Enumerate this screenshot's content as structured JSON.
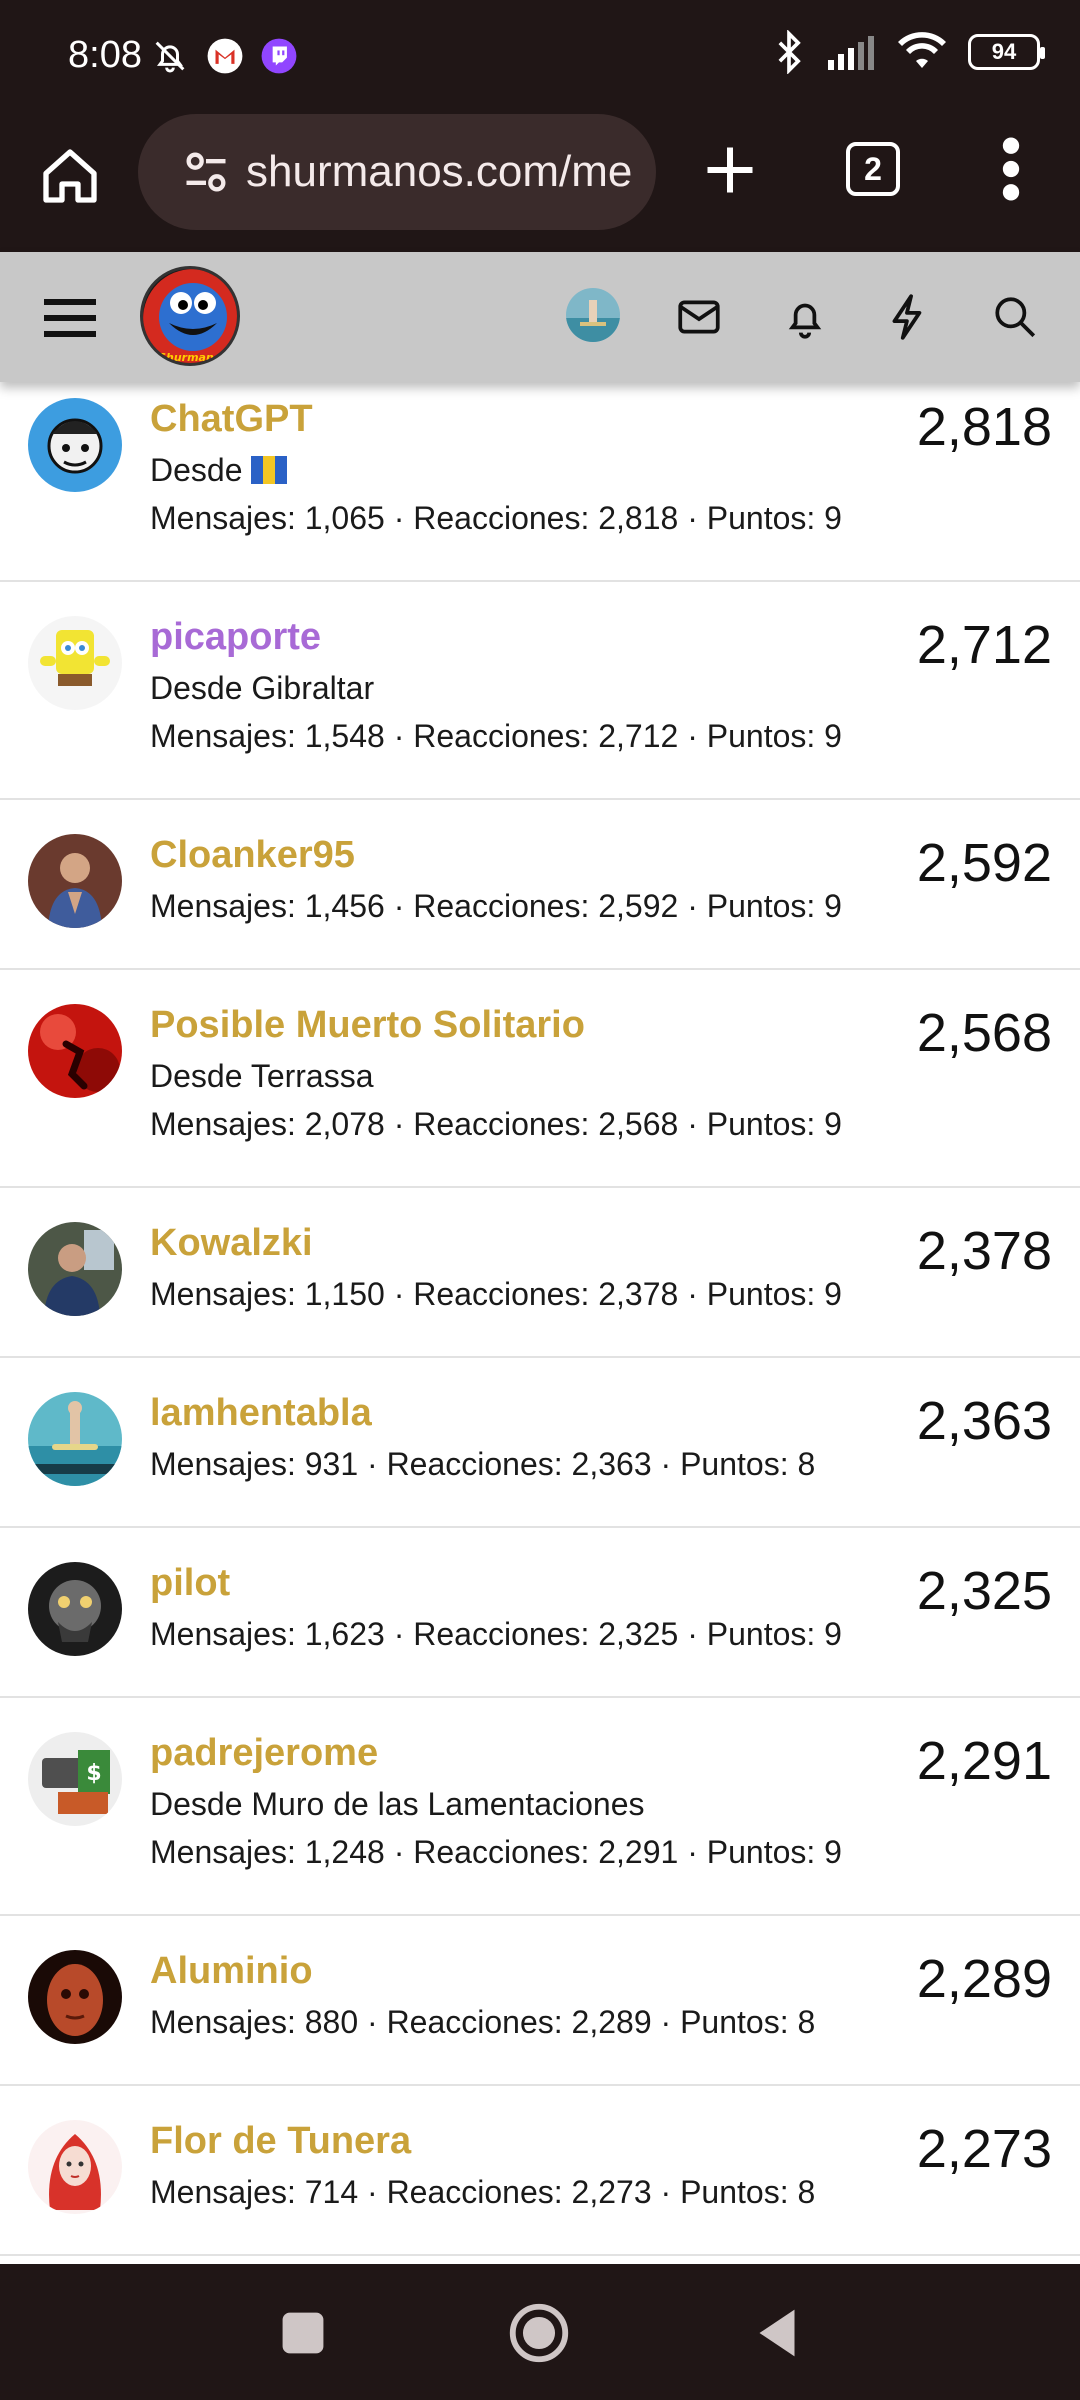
{
  "status_bar": {
    "time": "8:08",
    "battery": "94",
    "icons": [
      "mute-bell-icon",
      "gmail-icon",
      "twitch-icon",
      "bluetooth-icon",
      "signal-icon",
      "wifi-icon"
    ]
  },
  "browser": {
    "url": "shurmanos.com/me",
    "tab_count": "2"
  },
  "site_header": {
    "logo_text": "Shurmanos"
  },
  "members": [
    {
      "name": "ChatGPT",
      "location": "Desde",
      "has_flag": true,
      "stats": "Mensajes: 1,065 · Reacciones: 2,818 · Puntos: 9",
      "score": "2,818",
      "name_color": "#c9a23a",
      "avatar": "avatar-chatgpt"
    },
    {
      "name": "picaporte",
      "location": "Desde Gibraltar",
      "stats": "Mensajes: 1,548 · Reacciones: 2,712 · Puntos: 9",
      "score": "2,712",
      "name_color": "#a86ad6",
      "avatar": "avatar-picaporte"
    },
    {
      "name": "Cloanker95",
      "location": "",
      "stats": "Mensajes: 1,456 · Reacciones: 2,592 · Puntos: 9",
      "score": "2,592",
      "name_color": "#c9a23a",
      "avatar": "avatar-cloanker95"
    },
    {
      "name": "Posible Muerto Solitario",
      "location": "Desde Terrassa",
      "stats": "Mensajes: 2,078 · Reacciones: 2,568 · Puntos: 9",
      "score": "2,568",
      "name_color": "#c9a23a",
      "avatar": "avatar-posible"
    },
    {
      "name": "Kowalzki",
      "location": "",
      "stats": "Mensajes: 1,150 · Reacciones: 2,378 · Puntos: 9",
      "score": "2,378",
      "name_color": "#c9a23a",
      "avatar": "avatar-kowalzki"
    },
    {
      "name": "lamhentabla",
      "location": "",
      "stats": "Mensajes: 931 · Reacciones: 2,363 · Puntos: 8",
      "score": "2,363",
      "name_color": "#c9a23a",
      "avatar": "avatar-lamhentabla"
    },
    {
      "name": "pilot",
      "location": "",
      "stats": "Mensajes: 1,623 · Reacciones: 2,325 · Puntos: 9",
      "score": "2,325",
      "name_color": "#c9a23a",
      "avatar": "avatar-pilot"
    },
    {
      "name": "padrejerome",
      "location": "Desde Muro de las Lamentaciones",
      "stats": "Mensajes: 1,248 · Reacciones: 2,291 · Puntos: 9",
      "score": "2,291",
      "name_color": "#c9a23a",
      "avatar": "avatar-padrejerome"
    },
    {
      "name": "Aluminio",
      "location": "",
      "stats": "Mensajes: 880 · Reacciones: 2,289 · Puntos: 8",
      "score": "2,289",
      "name_color": "#c9a23a",
      "avatar": "avatar-aluminio"
    },
    {
      "name": "Flor de Tunera",
      "location": "",
      "stats": "Mensajes: 714 · Reacciones: 2,273 · Puntos: 8",
      "score": "2,273",
      "name_color": "#c9a23a",
      "avatar": "avatar-flor"
    }
  ]
}
